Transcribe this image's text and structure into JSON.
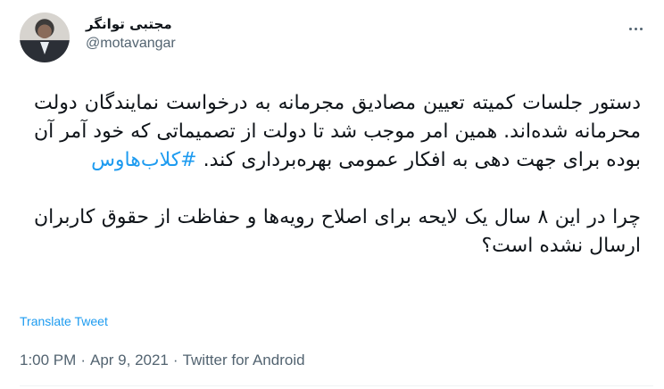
{
  "author": {
    "display_name": "مجتبی توانگر",
    "handle": "@motavangar"
  },
  "tweet": {
    "paragraph1": "دستور جلسات کمیته تعیین مصادیق مجرمانه به درخواست نمایندگان دولت محرمانه شده‌اند. همین امر موجب شد تا دولت از تصمیماتی که خود آمر آن بوده برای جهت دهی به افکار عمومی بهره‌برداری کند.",
    "hashtag": "#کلاب‌هاوس",
    "paragraph2": "چرا در این ۸ سال یک لایحه برای اصلاح رویه‌ها و حفاظت از حقوق کاربران ارسال نشده است؟"
  },
  "translate_label": "Translate Tweet",
  "meta": {
    "time": "1:00 PM",
    "separator": "·",
    "date": "Apr 9, 2021",
    "source": "Twitter for Android"
  },
  "colors": {
    "link": "#1d9bf0",
    "secondary_text": "#536471",
    "primary_text": "#0f1419"
  },
  "icons": {
    "more": "more-horizontal-icon"
  }
}
